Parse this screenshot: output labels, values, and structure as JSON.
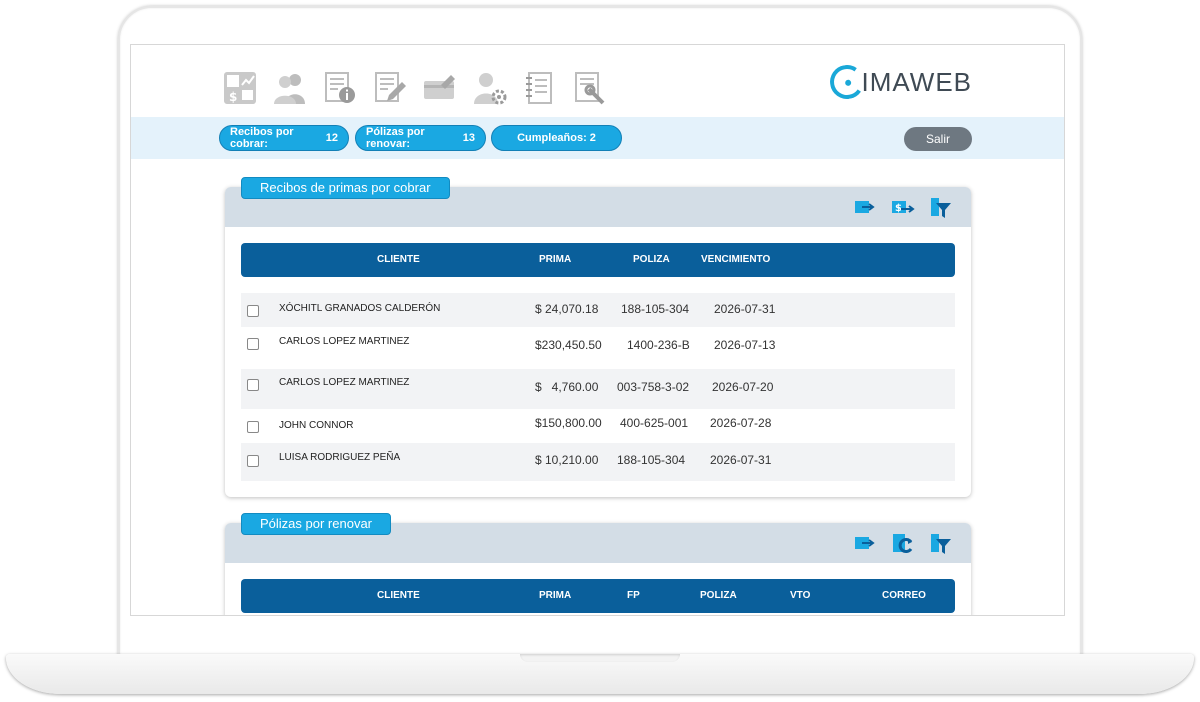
{
  "nav": {
    "icons": [
      "finance-dashboard-icon",
      "clients-icon",
      "policy-info-icon",
      "policy-edit-icon",
      "payment-card-icon",
      "user-settings-icon",
      "notebook-icon",
      "document-tools-icon"
    ]
  },
  "logo": {
    "text": "IMAWEB"
  },
  "status": {
    "recibos_label": "Recibos por cobrar:",
    "recibos_count": "12",
    "polizas_label": "Pólizas por renovar:",
    "polizas_count": "13",
    "cumple_label": "Cumpleaños:",
    "cumple_count": "2",
    "logout": "Salir"
  },
  "recibos_panel": {
    "title": "Recibos de primas por cobrar",
    "columns": {
      "cliente": "CLIENTE",
      "prima": "PRIMA",
      "poliza": "POLIZA",
      "vencimiento": "VENCIMIENTO"
    },
    "rows": [
      {
        "cliente": "XÓCHITL GRANADOS CALDERÓN",
        "prima": "$ 24,070.18",
        "poliza": "188-105-304",
        "vencimiento": "2026-07-31"
      },
      {
        "cliente": "CARLOS LOPEZ MARTINEZ",
        "prima": "$230,450.50",
        "poliza": "1400-236-B",
        "vencimiento": "2026-07-13"
      },
      {
        "cliente": "CARLOS LOPEZ MARTINEZ",
        "prima": "$   4,760.00",
        "poliza": "003-758-3-02",
        "vencimiento": "2026-07-20"
      },
      {
        "cliente": "JOHN CONNOR",
        "prima": "$150,800.00",
        "poliza": "400-625-001",
        "vencimiento": "2026-07-28"
      },
      {
        "cliente": "LUISA RODRIGUEZ PEÑA",
        "prima": "$ 10,210.00",
        "poliza": "188-105-304",
        "vencimiento": "2026-07-31"
      }
    ]
  },
  "polizas_panel": {
    "title": "Pólizas por renovar",
    "columns": {
      "cliente": "CLIENTE",
      "prima": "PRIMA",
      "fp": "FP",
      "poliza": "POLIZA",
      "vto": "VTO",
      "correo": "CORREO"
    }
  },
  "colors": {
    "accent": "#1aa8e2",
    "header_blue": "#0a5f9b",
    "strip": "#e4f2fb",
    "panel_head": "#d3dde6"
  }
}
